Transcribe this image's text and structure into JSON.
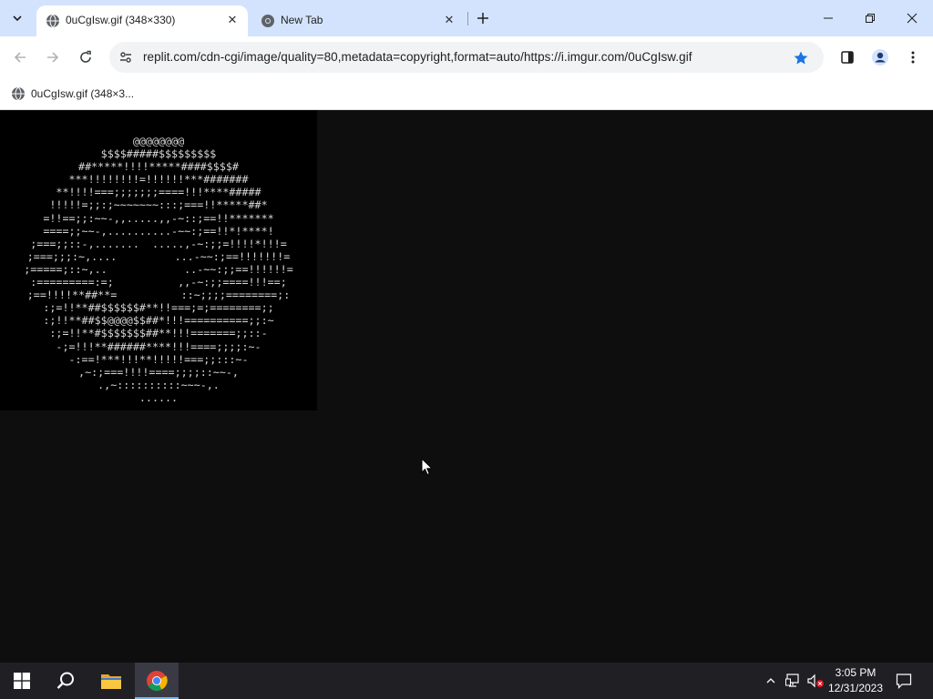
{
  "browser": {
    "tabs": [
      {
        "title": "0uCgIsw.gif (348×330)",
        "active": true
      },
      {
        "title": "New Tab",
        "active": false
      }
    ],
    "address": "replit.com/cdn-cgi/image/quality=80,metadata=copyright,format=auto/https://i.imgur.com/0uCgIsw.gif",
    "bookmarked": true,
    "bookmarks": [
      {
        "label": "0uCgIsw.gif (348×3..."
      }
    ],
    "accent_color": "#1a73e8",
    "tabstrip_color": "#d3e3fd"
  },
  "content": {
    "ascii_art": "@@@@@@@@\n$$$$#####$$$$$$$$$\n##*****!!!!*****####$$$$#\n***!!!!!!!!=!!!!!!***#######\n**!!!!===;;;;;;;====!!!****#####\n!!!!!=;;:;~~~~~~~:::;===!!*****##*\n=!!==;;:~~-,,.....,,-~::;==!!*******\n====;;~~-,..........-~~:;==!!*!****!\n;===;;::-,.......  .....,-~:;;=!!!!*!!!=\n;===;;;:~,....         ...-~~:;==!!!!!!!=\n;=====;::~,..            ..-~~:;;==!!!!!!=\n:=========:=;          ,,-~:;;====!!!==;\n;==!!!!**##**=          ::~;;;;========;:\n:;=!!**##$$$$$$#**!!===;=;========;;\n:;!!**##$$@@@@$$##*!!!==========;;:~\n:;=!!**#$$$$$$$##**!!!=======;;::-\n-;=!!!**######****!!!====;;;;:~-\n-:==!***!!!**!!!!!===;;:::~-\n,~:;===!!!!====;;;;::~~-,\n.,~::::::::::~~~-,.\n......"
  },
  "cursor": {
    "shape": "arrow-pointer"
  },
  "taskbar": {
    "apps": [
      "start",
      "search",
      "file-explorer",
      "chrome"
    ],
    "active_app": "chrome",
    "time": "3:05 PM",
    "date": "12/31/2023"
  }
}
